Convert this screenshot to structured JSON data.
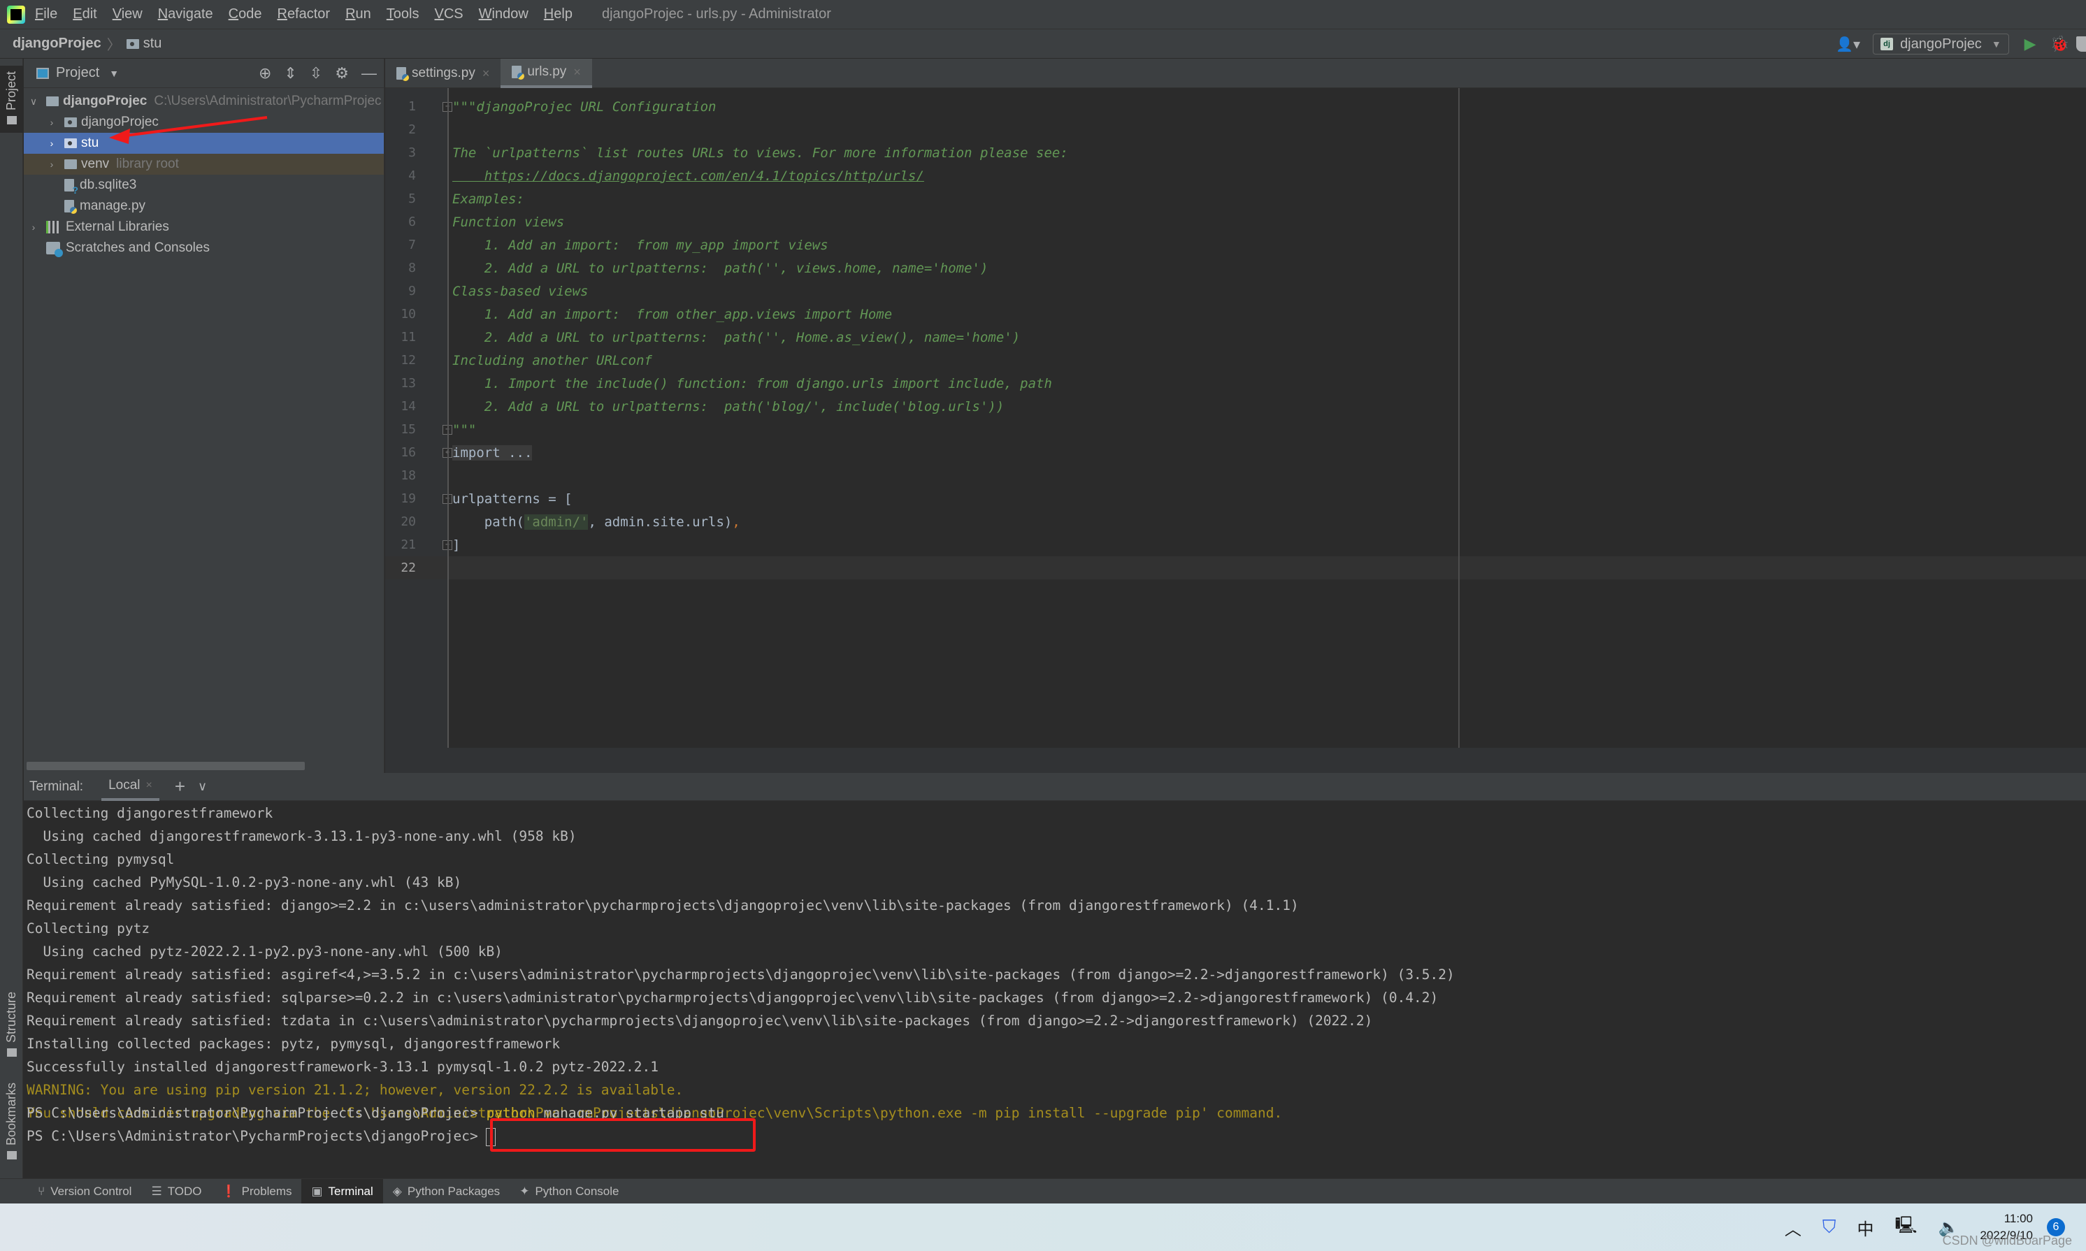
{
  "window": {
    "title": "djangoProjec - urls.py - Administrator"
  },
  "menubar": {
    "items": [
      "File",
      "Edit",
      "View",
      "Navigate",
      "Code",
      "Refactor",
      "Run",
      "Tools",
      "VCS",
      "Window",
      "Help"
    ]
  },
  "navbar": {
    "breadcrumb_root": "djangoProjec",
    "breadcrumb_sep": "〉",
    "breadcrumb_folder": "stu",
    "run_config": "djangoProjec",
    "run_config_badge": "dj"
  },
  "left_stripe": {
    "project": "Project",
    "structure": "Structure",
    "bookmarks": "Bookmarks"
  },
  "project_panel": {
    "header_label": "Project",
    "tree": [
      {
        "name": "djangoProjec",
        "hint": "C:\\Users\\Administrator\\PycharmProjec",
        "type": "root",
        "expanded": true
      },
      {
        "name": "djangoProjec",
        "type": "package"
      },
      {
        "name": "stu",
        "type": "package",
        "selected": true
      },
      {
        "name": "venv",
        "hint": "library root",
        "type": "folder"
      },
      {
        "name": "db.sqlite3",
        "type": "file-unknown"
      },
      {
        "name": "manage.py",
        "type": "file-python"
      },
      {
        "name": "External Libraries",
        "type": "libraries"
      },
      {
        "name": "Scratches and Consoles",
        "type": "scratches"
      }
    ]
  },
  "editor": {
    "tabs": [
      {
        "label": "settings.py",
        "active": false
      },
      {
        "label": "urls.py",
        "active": true
      }
    ],
    "lines": [
      {
        "n": "1",
        "text": "\"\"\"djangoProjec URL Configuration"
      },
      {
        "n": "2",
        "text": ""
      },
      {
        "n": "3",
        "text": "The `urlpatterns` list routes URLs to views. For more information please see:"
      },
      {
        "n": "4",
        "text": "    https://docs.djangoproject.com/en/4.1/topics/http/urls/"
      },
      {
        "n": "5",
        "text": "Examples:"
      },
      {
        "n": "6",
        "text": "Function views"
      },
      {
        "n": "7",
        "text": "    1. Add an import:  from my_app import views"
      },
      {
        "n": "8",
        "text": "    2. Add a URL to urlpatterns:  path('', views.home, name='home')"
      },
      {
        "n": "9",
        "text": "Class-based views"
      },
      {
        "n": "10",
        "text": "    1. Add an import:  from other_app.views import Home"
      },
      {
        "n": "11",
        "text": "    2. Add a URL to urlpatterns:  path('', Home.as_view(), name='home')"
      },
      {
        "n": "12",
        "text": "Including another URLconf"
      },
      {
        "n": "13",
        "text": "    1. Import the include() function: from django.urls import include, path"
      },
      {
        "n": "14",
        "text": "    2. Add a URL to urlpatterns:  path('blog/', include('blog.urls'))"
      },
      {
        "n": "15",
        "text": "\"\"\""
      },
      {
        "n": "16",
        "text": "import ..."
      },
      {
        "n": "18",
        "text": ""
      },
      {
        "n": "19",
        "text": "urlpatterns = ["
      },
      {
        "n": "20",
        "pre": "    path(",
        "str1": "'admin/'",
        "mid": ", admin.site.urls)",
        "comma": ","
      },
      {
        "n": "21",
        "text": "]"
      },
      {
        "n": "22",
        "text": ""
      }
    ],
    "current_line": "22"
  },
  "terminal": {
    "title": "Terminal:",
    "tab": "Local",
    "lines": [
      {
        "text": "Collecting djangorestframework",
        "kind": "normal"
      },
      {
        "text": "  Using cached djangorestframework-3.13.1-py3-none-any.whl (958 kB)",
        "kind": "normal"
      },
      {
        "text": "Collecting pymysql",
        "kind": "normal"
      },
      {
        "text": "  Using cached PyMySQL-1.0.2-py3-none-any.whl (43 kB)",
        "kind": "normal"
      },
      {
        "text": "Requirement already satisfied: django>=2.2 in c:\\users\\administrator\\pycharmprojects\\djangoprojec\\venv\\lib\\site-packages (from djangorestframework) (4.1.1)",
        "kind": "normal"
      },
      {
        "text": "Collecting pytz",
        "kind": "normal"
      },
      {
        "text": "  Using cached pytz-2022.2.1-py2.py3-none-any.whl (500 kB)",
        "kind": "normal"
      },
      {
        "text": "Requirement already satisfied: asgiref<4,>=3.5.2 in c:\\users\\administrator\\pycharmprojects\\djangoprojec\\venv\\lib\\site-packages (from django>=2.2->djangorestframework) (3.5.2)",
        "kind": "normal"
      },
      {
        "text": "Requirement already satisfied: sqlparse>=0.2.2 in c:\\users\\administrator\\pycharmprojects\\djangoprojec\\venv\\lib\\site-packages (from django>=2.2->djangorestframework) (0.4.2)",
        "kind": "normal"
      },
      {
        "text": "Requirement already satisfied: tzdata in c:\\users\\administrator\\pycharmprojects\\djangoprojec\\venv\\lib\\site-packages (from django>=2.2->djangorestframework) (2022.2)",
        "kind": "normal"
      },
      {
        "text": "Installing collected packages: pytz, pymysql, djangorestframework",
        "kind": "normal"
      },
      {
        "text": "Successfully installed djangorestframework-3.13.1 pymysql-1.0.2 pytz-2022.2.1",
        "kind": "normal"
      },
      {
        "text": "WARNING: You are using pip version 21.1.2; however, version 22.2.2 is available.",
        "kind": "warn"
      },
      {
        "text": "You should consider upgrading via the 'C:\\Users\\Administrator\\PycharmProjects\\djangoProjec\\venv\\Scripts\\python.exe -m pip install --upgrade pip' command.",
        "kind": "warn"
      }
    ],
    "prompt": "PS C:\\Users\\Administrator\\PycharmProjects\\djangoProjec> ",
    "command_exe": "python",
    "command_args": " manage.py startapp stu"
  },
  "bottom_bar": {
    "items": [
      {
        "label": "Version Control",
        "icon": "branch-icon",
        "active": false
      },
      {
        "label": "TODO",
        "icon": "list-icon",
        "active": false
      },
      {
        "label": "Problems",
        "icon": "warning-circle-icon",
        "active": false
      },
      {
        "label": "Terminal",
        "icon": "terminal-icon",
        "active": true
      },
      {
        "label": "Python Packages",
        "icon": "packages-icon",
        "active": false
      },
      {
        "label": "Python Console",
        "icon": "python-icon",
        "active": false
      }
    ]
  },
  "taskbar": {
    "ime": "中",
    "time": "11:00",
    "date": "2022/9/10",
    "notifications": "6",
    "watermark": "CSDN @wildBoarPage"
  },
  "colors": {
    "selection": "#4b6eaf",
    "doc_string": "#629755",
    "warning_text": "#a48d1e",
    "annotation_red": "#f01a1a"
  }
}
